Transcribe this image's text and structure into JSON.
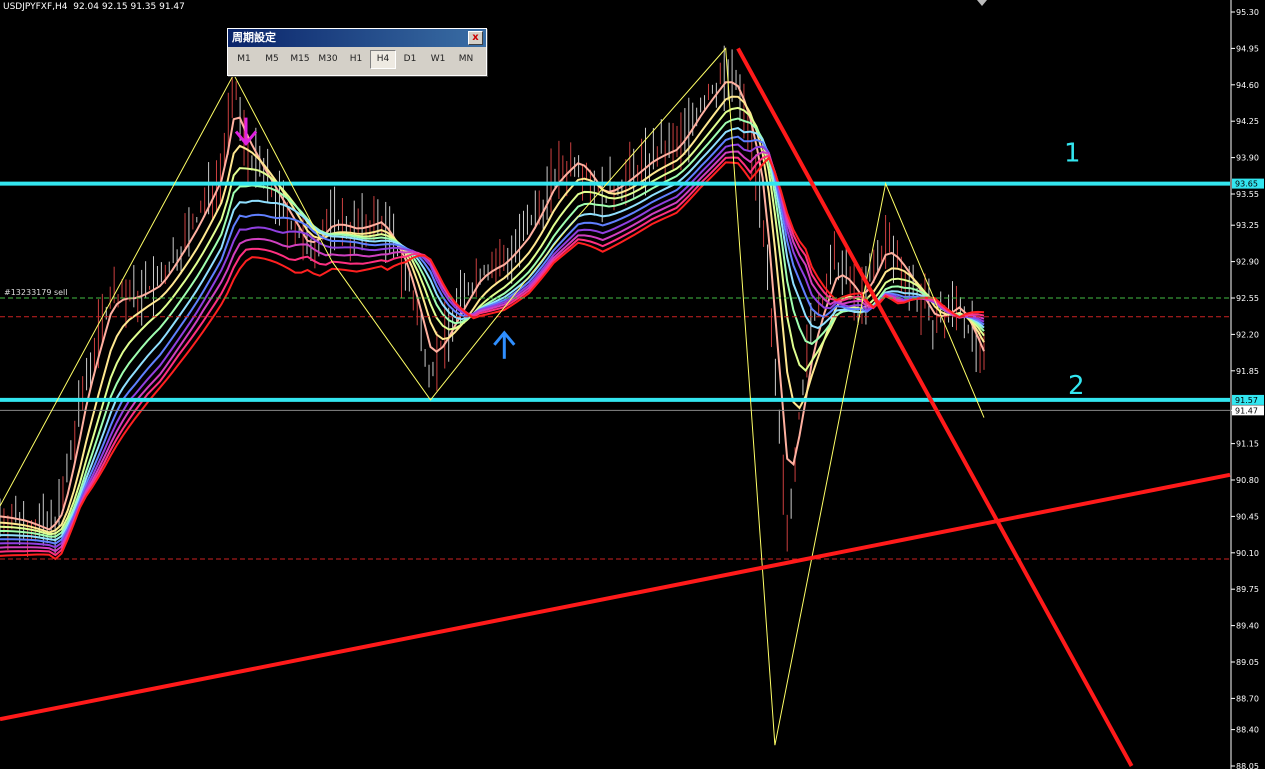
{
  "header": {
    "symbol": "USDJPYFXF,H4",
    "ohlc": "92.04 92.15 91.35 91.47"
  },
  "period_window": {
    "title": "周期設定",
    "close_label": "x",
    "buttons": [
      "M1",
      "M5",
      "M15",
      "M30",
      "H1",
      "H4",
      "D1",
      "W1",
      "MN"
    ],
    "active": "H4"
  },
  "annotations": {
    "order_label": "#13233179 sell",
    "level_1": "1",
    "level_2": "2",
    "level_1_tag": "93.65",
    "level_2_tag": "91.57",
    "last_price_tag": "91.47"
  },
  "colors": {
    "cyan": "#33e6f0",
    "trend_red": "#ff1a1a",
    "zigzag": "#ffff66",
    "arrow_down": "#e020e0",
    "arrow_up": "#2f8fff",
    "candle": "#ff5050"
  },
  "chart_data": {
    "type": "line",
    "title": "",
    "xlabel": "",
    "ylabel": "",
    "ylim": [
      88.05,
      95.3
    ],
    "y_ticks": [
      "95.30",
      "94.95",
      "94.60",
      "94.25",
      "93.90",
      "93.55",
      "93.25",
      "92.90",
      "92.55",
      "92.20",
      "91.85",
      "91.47",
      "91.15",
      "90.80",
      "90.45",
      "90.10",
      "89.75",
      "89.40",
      "89.05",
      "88.70",
      "88.40",
      "88.05"
    ],
    "grid": false,
    "horizontal_levels": [
      {
        "label": "1",
        "value": 93.65,
        "style": "solid-cyan"
      },
      {
        "label": "2",
        "value": 91.57,
        "style": "solid-cyan"
      },
      {
        "label": "#13233179 sell",
        "value": 92.55,
        "style": "dash-green"
      },
      {
        "value": 92.37,
        "style": "dash-red"
      },
      {
        "value": 90.04,
        "style": "dash-red"
      },
      {
        "value": 91.47,
        "style": "thin-gray"
      }
    ],
    "price_path": [
      [
        0,
        90.45
      ],
      [
        2,
        90.4
      ],
      [
        4,
        90.3
      ],
      [
        5,
        90.55
      ],
      [
        7,
        91.8
      ],
      [
        9,
        92.6
      ],
      [
        11,
        92.55
      ],
      [
        13,
        92.7
      ],
      [
        16,
        93.3
      ],
      [
        18,
        93.8
      ],
      [
        19,
        94.6
      ],
      [
        20,
        94.0
      ],
      [
        21,
        93.8
      ],
      [
        23,
        93.4
      ],
      [
        25,
        93.0
      ],
      [
        27,
        93.3
      ],
      [
        29,
        93.2
      ],
      [
        31,
        93.3
      ],
      [
        33,
        92.8
      ],
      [
        35,
        91.85
      ],
      [
        37,
        92.4
      ],
      [
        39,
        92.8
      ],
      [
        41,
        92.9
      ],
      [
        43,
        93.2
      ],
      [
        45,
        93.7
      ],
      [
        47,
        93.9
      ],
      [
        49,
        93.5
      ],
      [
        51,
        93.7
      ],
      [
        53,
        93.9
      ],
      [
        55,
        94.0
      ],
      [
        57,
        94.4
      ],
      [
        59,
        94.7
      ],
      [
        60,
        94.55
      ],
      [
        61,
        94.1
      ],
      [
        62,
        93.4
      ],
      [
        63,
        91.7
      ],
      [
        64,
        90.3
      ],
      [
        65,
        91.5
      ],
      [
        66,
        92.3
      ],
      [
        68,
        92.9
      ],
      [
        70,
        92.5
      ],
      [
        72,
        93.1
      ],
      [
        74,
        92.7
      ],
      [
        76,
        92.3
      ],
      [
        78,
        92.5
      ],
      [
        80,
        91.9
      ]
    ],
    "zigzag": [
      [
        0,
        90.55
      ],
      [
        19,
        94.7
      ],
      [
        27,
        92.9
      ],
      [
        35,
        91.57
      ],
      [
        46,
        93.2
      ],
      [
        59,
        94.95
      ],
      [
        63,
        88.25
      ],
      [
        72,
        93.65
      ],
      [
        80,
        91.4
      ]
    ],
    "trendlines": [
      {
        "from": [
          0,
          88.5
        ],
        "to": [
          100,
          90.85
        ]
      },
      {
        "from": [
          60,
          94.95
        ],
        "to": [
          92,
          88.05
        ]
      }
    ],
    "ribbon_series": [
      {
        "color": "#ffb0a0",
        "offset": 0.0,
        "period": 3
      },
      {
        "color": "#ffe890",
        "offset": -0.06,
        "period": 6
      },
      {
        "color": "#e0ff90",
        "offset": -0.1,
        "period": 9
      },
      {
        "color": "#a0ffb0",
        "offset": -0.14,
        "period": 12
      },
      {
        "color": "#90e0ff",
        "offset": -0.18,
        "period": 15
      },
      {
        "color": "#6080ff",
        "offset": -0.22,
        "period": 18
      },
      {
        "color": "#9040e0",
        "offset": -0.26,
        "period": 21
      },
      {
        "color": "#d040c0",
        "offset": -0.3,
        "period": 24
      },
      {
        "color": "#ff3080",
        "offset": -0.34,
        "period": 27
      },
      {
        "color": "#ff2020",
        "offset": -0.38,
        "period": 30
      }
    ],
    "arrows": [
      {
        "dir": "down",
        "x": 20,
        "y": 94.15
      },
      {
        "dir": "up",
        "x": 41,
        "y": 92.1
      }
    ]
  }
}
